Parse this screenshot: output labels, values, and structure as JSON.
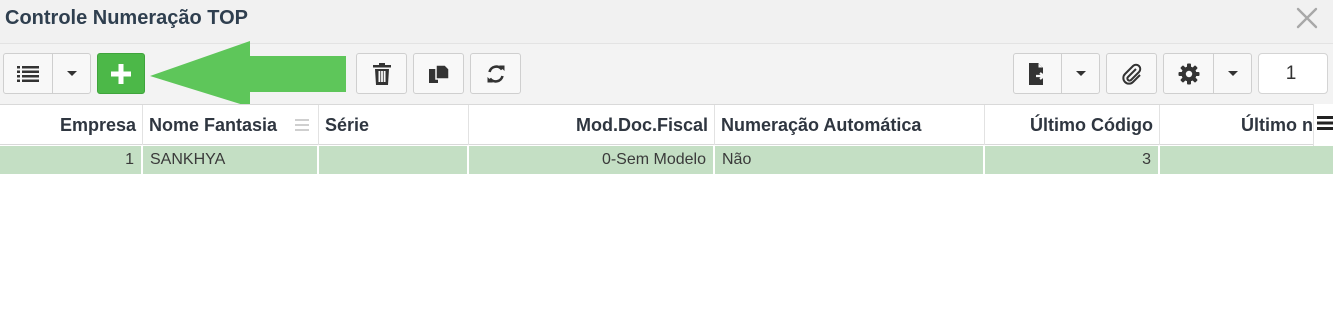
{
  "window": {
    "title": "Controle Numeração TOP"
  },
  "toolbar": {
    "list_view_icon": "list-icon",
    "dropdown_icon": "caret-down-icon",
    "add_icon": "plus-icon",
    "delete_icon": "trash-icon",
    "duplicate_icon": "copy-icon",
    "refresh_icon": "refresh-icon",
    "export_icon": "export-file-icon",
    "attach_icon": "paperclip-icon",
    "settings_icon": "gear-icon",
    "page_value": "1",
    "add_button_color": "#4cb848",
    "annotation_arrow_color": "#5ec65a"
  },
  "grid": {
    "columns": [
      {
        "label": "Empresa"
      },
      {
        "label": "Nome Fantasia"
      },
      {
        "label": "Série"
      },
      {
        "label": "Mod.Doc.Fiscal"
      },
      {
        "label": "Numeração Automática"
      },
      {
        "label": "Último Código"
      },
      {
        "label": "Último n"
      }
    ],
    "rows": [
      {
        "cells": [
          "1",
          "SANKHYA",
          "",
          "0-Sem Modelo",
          "Não",
          "3",
          ""
        ]
      }
    ],
    "selected_row_color": "#c4dfc4"
  }
}
